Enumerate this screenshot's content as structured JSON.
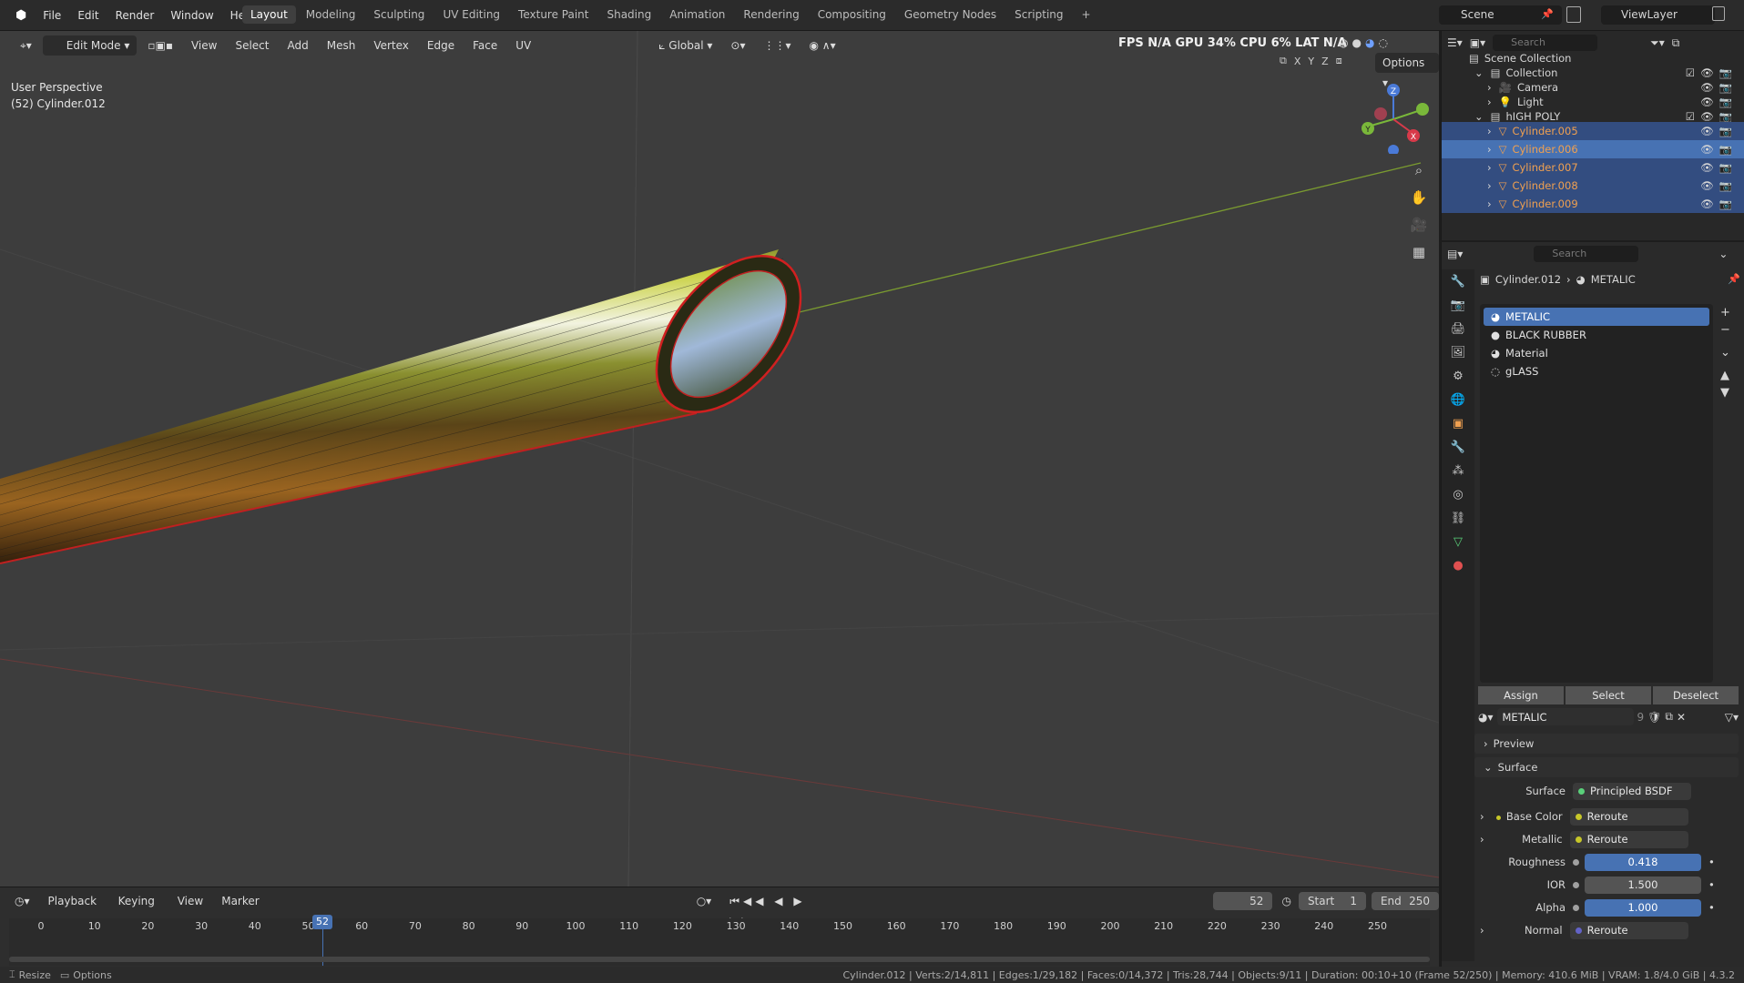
{
  "menu": [
    "File",
    "Edit",
    "Render",
    "Window",
    "Help"
  ],
  "workspaces": [
    "Layout",
    "Modeling",
    "Sculpting",
    "UV Editing",
    "Texture Paint",
    "Shading",
    "Animation",
    "Rendering",
    "Compositing",
    "Geometry Nodes",
    "Scripting"
  ],
  "active_workspace": "Layout",
  "scene": "Scene",
  "view_layer": "ViewLayer",
  "viewport": {
    "mode": "Edit Mode",
    "menus": [
      "View",
      "Select",
      "Add",
      "Mesh",
      "Vertex",
      "Edge",
      "Face",
      "UV"
    ],
    "orientation": "Global",
    "stats": "FPS N/A GPU 34% CPU 6% LAT N/A",
    "options": "Options",
    "axes": [
      "X",
      "Y",
      "Z"
    ],
    "perspective": "User Perspective",
    "object_label": "(52) Cylinder.012",
    "gizmo": {
      "x": "X",
      "y": "Y",
      "z": "Z"
    }
  },
  "outliner": {
    "search_placeholder": "Search",
    "scene_collection": "Scene Collection",
    "collection": "Collection",
    "camera": "Camera",
    "light": "Light",
    "high_poly": "hIGH POLY",
    "objects": [
      "Cylinder.005",
      "Cylinder.006",
      "Cylinder.007",
      "Cylinder.008",
      "Cylinder.009"
    ]
  },
  "properties": {
    "search_placeholder": "Search",
    "breadcrumb_object": "Cylinder.012",
    "breadcrumb_material": "METALIC",
    "materials": [
      "METALIC",
      "BLACK RUBBER",
      "Material",
      "gLASS"
    ],
    "assign": "Assign",
    "select": "Select",
    "deselect": "Deselect",
    "material_name": "METALIC",
    "user_count": "9",
    "preview": "Preview",
    "surface_header": "Surface",
    "surface_label": "Surface",
    "surface_value": "Principled BSDF",
    "base_color_label": "Base Color",
    "base_color_value": "Reroute",
    "metallic_label": "Metallic",
    "metallic_value": "Reroute",
    "roughness_label": "Roughness",
    "roughness_value": "0.418",
    "ior_label": "IOR",
    "ior_value": "1.500",
    "alpha_label": "Alpha",
    "alpha_value": "1.000",
    "normal_label": "Normal",
    "normal_value": "Reroute"
  },
  "timeline": {
    "menus": [
      "Playback",
      "Keying",
      "View",
      "Marker"
    ],
    "current_frame": "52",
    "start_label": "Start",
    "start": "1",
    "end_label": "End",
    "end": "250",
    "ticks": [
      "0",
      "10",
      "20",
      "30",
      "40",
      "50",
      "60",
      "70",
      "80",
      "90",
      "100",
      "110",
      "120",
      "130",
      "140",
      "150",
      "160",
      "170",
      "180",
      "190",
      "200",
      "210",
      "220",
      "230",
      "240",
      "250"
    ]
  },
  "status": {
    "resize": "Resize",
    "options": "Options",
    "info": "Cylinder.012 | Verts:2/14,811 | Edges:1/29,182 | Faces:0/14,372 | Tris:28,744 | Objects:9/11 | Duration: 00:10+10 (Frame 52/250) | Memory: 410.6 MiB | VRAM: 1.8/4.0 GiB | 4.3.2"
  },
  "colors": {
    "accent": "#4772b3",
    "selection": "#334d80",
    "object_orange": "#f0a050",
    "viewport_bg": "#3d3d3d"
  }
}
